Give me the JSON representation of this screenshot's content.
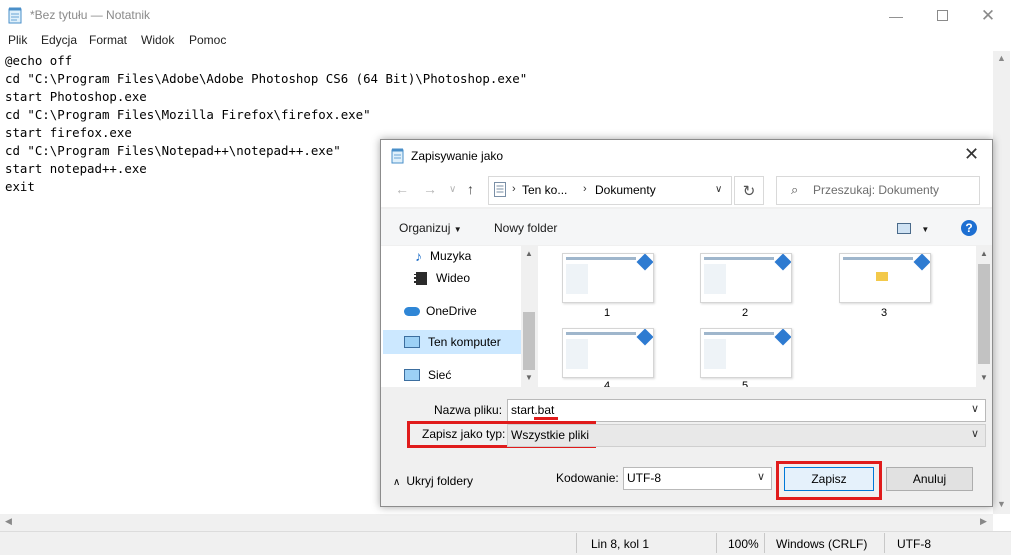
{
  "notepad": {
    "title": "*Bez tytułu — Notatnik",
    "menu": [
      "Plik",
      "Edycja",
      "Format",
      "Widok",
      "Pomoc"
    ],
    "content": "@echo off\ncd \"C:\\Program Files\\Adobe\\Adobe Photoshop CS6 (64 Bit)\\Photoshop.exe\"\nstart Photoshop.exe\ncd \"C:\\Program Files\\Mozilla Firefox\\firefox.exe\"\nstart firefox.exe\ncd \"C:\\Program Files\\Notepad++\\notepad++.exe\"\nstart notepad++.exe\nexit",
    "status": {
      "position": "Lin 8, kol 1",
      "zoom": "100%",
      "line_endings": "Windows (CRLF)",
      "encoding": "UTF-8"
    }
  },
  "dialog": {
    "title": "Zapisywanie jako",
    "breadcrumb": [
      "Ten ko...",
      "Dokumenty"
    ],
    "search_placeholder": "Przeszukaj: Dokumenty",
    "toolbar": {
      "organize": "Organizuj",
      "new_folder": "Nowy folder"
    },
    "nav_items": [
      "Muzyka",
      "Wideo",
      "OneDrive",
      "Ten komputer",
      "Sieć"
    ],
    "thumbnails": [
      "1",
      "2",
      "3",
      "4",
      "5"
    ],
    "filename_label": "Nazwa pliku:",
    "filename_value": "start.bat",
    "filetype_label": "Zapisz jako typ:",
    "filetype_value": "Wszystkie pliki",
    "hide_folders": "Ukryj foldery",
    "encoding_label": "Kodowanie:",
    "encoding_value": "UTF-8",
    "save_button": "Zapisz",
    "cancel_button": "Anuluj"
  },
  "colors": {
    "highlight": "#e01b1b",
    "selected_nav": "#cce8ff",
    "accent_blue": "#1d6fd2"
  }
}
